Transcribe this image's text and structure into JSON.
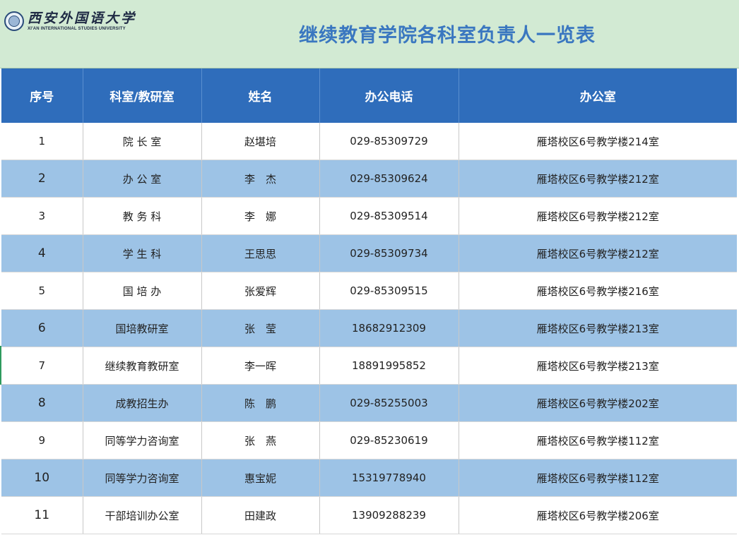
{
  "header": {
    "logo_cn": "西安外国语大学",
    "logo_en": "XI'AN INTERNATIONAL STUDIES UNIVERSITY",
    "title": "继续教育学院各科室负责人一览表"
  },
  "table": {
    "columns": [
      "序号",
      "科室/教研室",
      "姓名",
      "办公电话",
      "办公室"
    ],
    "rows": [
      {
        "no": "1",
        "dept": "院 长 室",
        "name": "赵堪培",
        "phone": "029-85309729",
        "office": "雁塔校区6号教学楼214室"
      },
      {
        "no": "2",
        "dept": "办 公 室",
        "name": "李　杰",
        "phone": "029-85309624",
        "office": "雁塔校区6号教学楼212室"
      },
      {
        "no": "3",
        "dept": "教 务 科",
        "name": "李　娜",
        "phone": "029-85309514",
        "office": "雁塔校区6号教学楼212室"
      },
      {
        "no": "4",
        "dept": "学 生 科",
        "name": "王思思",
        "phone": "029-85309734",
        "office": "雁塔校区6号教学楼212室"
      },
      {
        "no": "5",
        "dept": "国 培 办",
        "name": "张爱辉",
        "phone": "029-85309515",
        "office": "雁塔校区6号教学楼216室"
      },
      {
        "no": "6",
        "dept": "国培教研室",
        "name": "张　莹",
        "phone": "18682912309",
        "office": "雁塔校区6号教学楼213室"
      },
      {
        "no": "7",
        "dept": "继续教育教研室",
        "name": "李一晖",
        "phone": "18891995852",
        "office": "雁塔校区6号教学楼213室"
      },
      {
        "no": "8",
        "dept": "成教招生办",
        "name": "陈　鹏",
        "phone": "029-85255003",
        "office": "雁塔校区6号教学楼202室"
      },
      {
        "no": "9",
        "dept": "同等学力咨询室",
        "name": "张　燕",
        "phone": "029-85230619",
        "office": "雁塔校区6号教学楼112室"
      },
      {
        "no": "10",
        "dept": "同等学力咨询室",
        "name": "惠宝妮",
        "phone": "15319778940",
        "office": "雁塔校区6号教学楼112室"
      },
      {
        "no": "11",
        "dept": "干部培训办公室",
        "name": "田建政",
        "phone": "13909288239",
        "office": "雁塔校区6号教学楼206室"
      }
    ]
  }
}
